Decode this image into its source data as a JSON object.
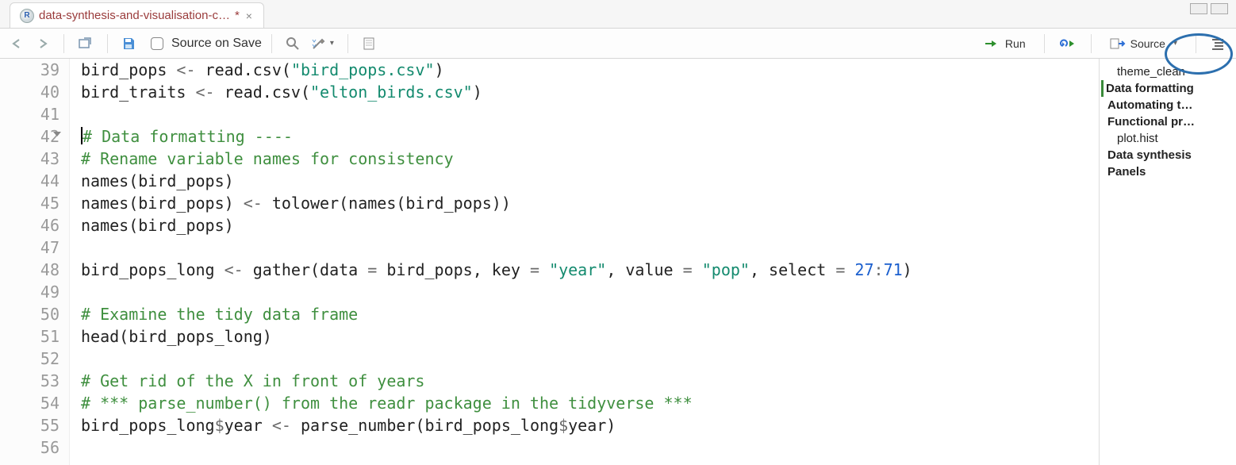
{
  "tab": {
    "title": "data-synthesis-and-visualisation-c…",
    "dirty_marker": "*"
  },
  "toolbar": {
    "source_on_save": "Source on Save",
    "run": "Run",
    "source": "Source"
  },
  "gutter": {
    "lines": [
      "39",
      "40",
      "41",
      "42",
      "43",
      "44",
      "45",
      "46",
      "47",
      "48",
      "49",
      "50",
      "51",
      "52",
      "53",
      "54",
      "55",
      "56"
    ],
    "fold_line_index": 3
  },
  "code": {
    "l39": {
      "a": "bird_pops ",
      "b": "<-",
      "c": " read.csv(",
      "d": "\"bird_pops.csv\"",
      "e": ")"
    },
    "l40": {
      "a": "bird_traits ",
      "b": "<-",
      "c": " read.csv(",
      "d": "\"elton_birds.csv\"",
      "e": ")"
    },
    "l41": "",
    "l42": "# Data formatting ----",
    "l43": "# Rename variable names for consistency",
    "l44": "names(bird_pops)",
    "l45": {
      "a": "names(bird_pops) ",
      "b": "<-",
      "c": " tolower(names(bird_pops))"
    },
    "l46": "names(bird_pops)",
    "l47": "",
    "l48": {
      "a": "bird_pops_long ",
      "b": "<-",
      "c": " gather(data ",
      "d": "=",
      "e": " bird_pops, key ",
      "f": "=",
      "g": " ",
      "h": "\"year\"",
      "i": ", value ",
      "j": "=",
      "k": " ",
      "l": "\"pop\"",
      "m": ", select ",
      "n": "=",
      "o": " ",
      "p": "27",
      "q": ":",
      "r": "71",
      "s": ")"
    },
    "l49": "",
    "l50": "# Examine the tidy data frame",
    "l51": "head(bird_pops_long)",
    "l52": "",
    "l53": "# Get rid of the X in front of years",
    "l54": "# *** parse_number() from the readr package in the tidyverse ***",
    "l55": {
      "a": "bird_pops_long",
      "b": "$",
      "c": "year ",
      "d": "<-",
      "e": " parse_number(bird_pops_long",
      "f": "$",
      "g": "year)"
    },
    "l56": ""
  },
  "outline": {
    "items": [
      {
        "label": "theme_clean",
        "bold": false,
        "sub": true,
        "active": false
      },
      {
        "label": "Data formatting",
        "bold": true,
        "sub": false,
        "active": true
      },
      {
        "label": "Automating t…",
        "bold": true,
        "sub": false,
        "active": false
      },
      {
        "label": "Functional pr…",
        "bold": true,
        "sub": false,
        "active": false
      },
      {
        "label": "plot.hist",
        "bold": false,
        "sub": true,
        "active": false
      },
      {
        "label": "Data synthesis",
        "bold": true,
        "sub": false,
        "active": false
      },
      {
        "label": "Panels",
        "bold": true,
        "sub": false,
        "active": false
      }
    ]
  }
}
